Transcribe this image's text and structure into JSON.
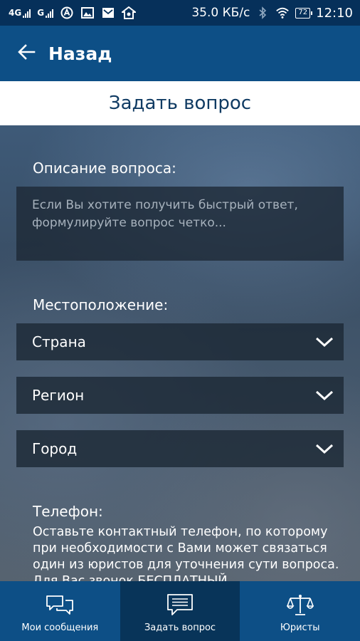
{
  "status_bar": {
    "network1": "4G",
    "network2": "G",
    "speed": "35.0 КБ/с",
    "battery": "72",
    "time": "12:10"
  },
  "app_bar": {
    "title": "Назад"
  },
  "page": {
    "title": "Задать вопрос"
  },
  "form": {
    "description_label": "Описание вопроса:",
    "description_placeholder": "Если Вы хотите получить быстрый ответ, формулируйте вопрос четко...",
    "location_label": "Местоположение:",
    "country": "Страна",
    "region": "Регион",
    "city": "Город",
    "phone_label": "Телефон:",
    "phone_description": "Оставьте контактный телефон, по которому при необходимости с Вами может связаться один из юристов для уточнения сути вопроса. Для Вас звонок БЕСПЛАТНЫЙ."
  },
  "bottom_nav": {
    "items": [
      {
        "label": "Мои сообщения",
        "icon": "chat-bubbles-icon"
      },
      {
        "label": "Задать вопрос",
        "icon": "message-icon"
      },
      {
        "label": "Юристы",
        "icon": "scales-icon"
      }
    ],
    "active_index": 1
  },
  "colors": {
    "status_bar": "#06305a",
    "app_bar": "#0d4f86",
    "nav_active": "#083459",
    "title_text": "#103b63"
  }
}
